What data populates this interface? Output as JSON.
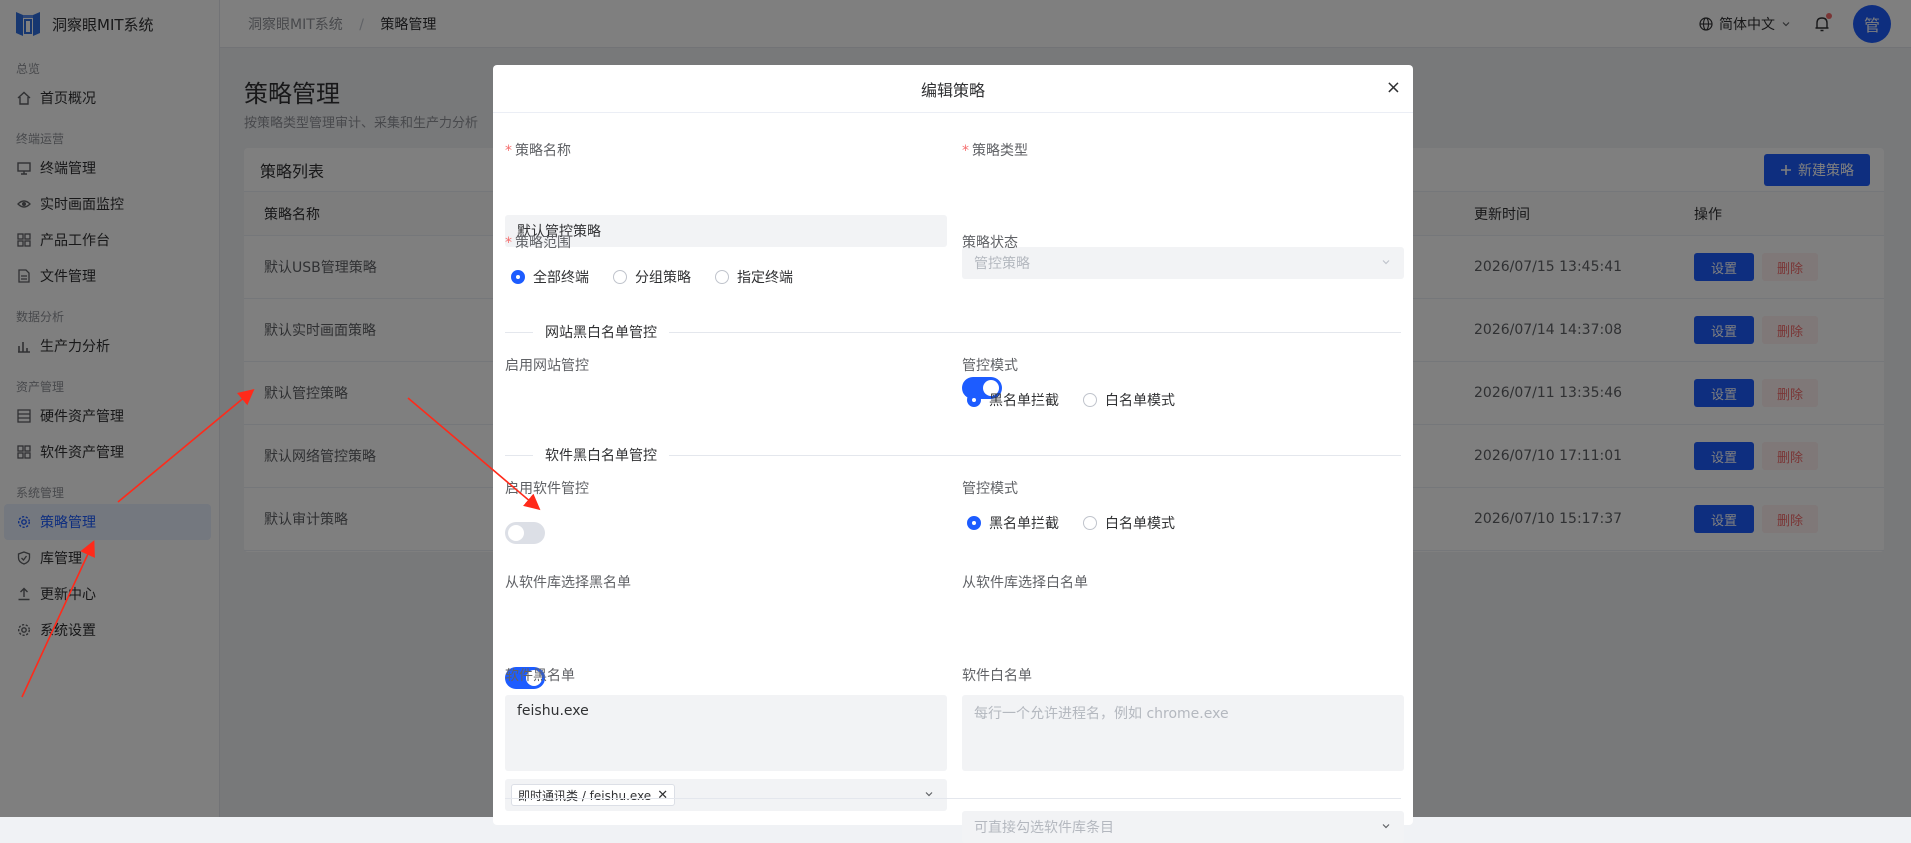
{
  "app": {
    "name": "洞察眼MIT系统"
  },
  "sidebar": {
    "groups": [
      {
        "title": "总览",
        "items": [
          {
            "label": "首页概况",
            "icon": "home-icon"
          }
        ]
      },
      {
        "title": "终端运营",
        "items": [
          {
            "label": "终端管理",
            "icon": "monitor-icon"
          },
          {
            "label": "实时画面监控",
            "icon": "eye-icon"
          },
          {
            "label": "产品工作台",
            "icon": "grid-icon"
          },
          {
            "label": "文件管理",
            "icon": "file-icon"
          }
        ]
      },
      {
        "title": "数据分析",
        "items": [
          {
            "label": "生产力分析",
            "icon": "bar-chart-icon"
          }
        ]
      },
      {
        "title": "资产管理",
        "items": [
          {
            "label": "硬件资产管理",
            "icon": "list-icon"
          },
          {
            "label": "软件资产管理",
            "icon": "grid-icon"
          }
        ]
      },
      {
        "title": "系统管理",
        "items": [
          {
            "label": "策略管理",
            "icon": "gear-icon",
            "active": true
          },
          {
            "label": "库管理",
            "icon": "shield-icon"
          },
          {
            "label": "更新中心",
            "icon": "upload-icon"
          },
          {
            "label": "系统设置",
            "icon": "gear-icon"
          }
        ]
      }
    ]
  },
  "header": {
    "breadcrumb": [
      "洞察眼MIT系统",
      "策略管理"
    ],
    "breadcrumb_sep": "/",
    "language": "简体中文",
    "avatar_text": "管"
  },
  "page": {
    "title": "策略管理",
    "subtitle": "按策略类型管理审计、采集和生产力分析"
  },
  "table": {
    "title": "策略列表",
    "new_button": "新建策略",
    "columns": {
      "name": "策略名称",
      "updated": "更新时间",
      "ops": "操作"
    },
    "set_label": "设置",
    "delete_label": "删除",
    "rows": [
      {
        "name": "默认USB管理策略",
        "updated": "2026/07/15 13:45:41"
      },
      {
        "name": "默认实时画面策略",
        "updated": "2026/07/14 14:37:08"
      },
      {
        "name": "默认管控策略",
        "updated": "2026/07/11 13:35:46"
      },
      {
        "name": "默认网络管控策略",
        "updated": "2026/07/10 17:11:01"
      },
      {
        "name": "默认审计策略",
        "updated": "2026/07/10 15:17:37"
      }
    ]
  },
  "dialog": {
    "title": "编辑策略",
    "close": "×",
    "name_label": "策略名称",
    "name_value": "默认管控策略",
    "type_label": "策略类型",
    "type_value": "管控策略",
    "scope_label": "策略范围",
    "scope_options": [
      "全部终端",
      "分组策略",
      "指定终端"
    ],
    "scope_selected": 0,
    "status_label": "策略状态",
    "status_on": true,
    "web_section": "网站黑白名单管控",
    "web_enable_label": "启用网站管控",
    "web_enable_on": false,
    "web_mode_label": "管控模式",
    "web_mode_options": [
      "黑名单拦截",
      "白名单模式"
    ],
    "sw_section": "软件黑白名单管控",
    "sw_enable_label": "启用软件管控",
    "sw_enable_on": true,
    "sw_mode_label": "管控模式",
    "sw_mode_options": [
      "黑名单拦截",
      "白名单模式"
    ],
    "black_select_label": "从软件库选择黑名单",
    "black_select_tag": "即时通讯类 / feishu.exe",
    "white_select_label": "从软件库选择白名单",
    "white_select_placeholder": "可直接勾选软件库条目",
    "blacklist_label": "软件黑名单",
    "blacklist_value": "feishu.exe",
    "whitelist_label": "软件白名单",
    "whitelist_placeholder": "每行一个允许进程名，例如 chrome.exe"
  },
  "colors": {
    "primary": "#1d5cff",
    "danger": "#f56c6c",
    "annotation": "#ff2a1a"
  }
}
